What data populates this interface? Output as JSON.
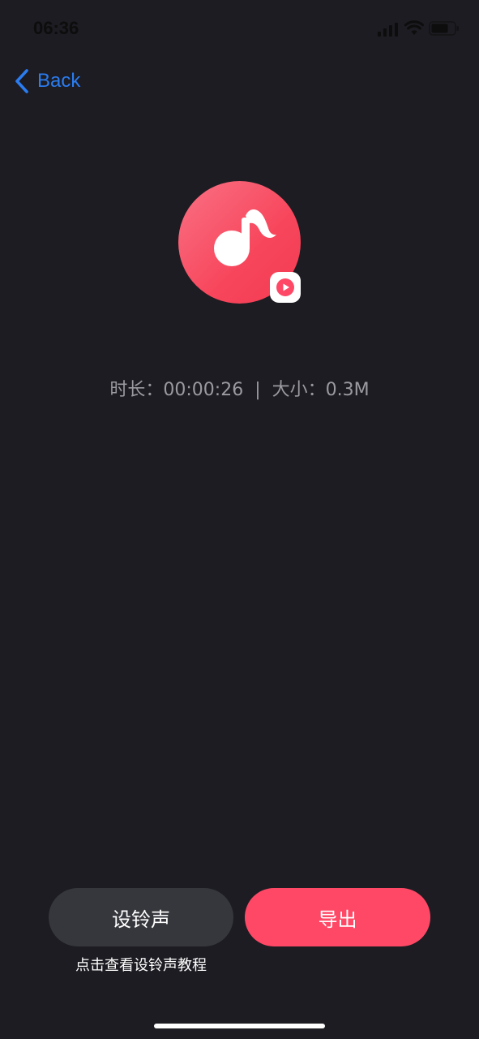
{
  "status_bar": {
    "time": "06:36",
    "icons": [
      "signal-icon",
      "wifi-icon",
      "battery-icon"
    ]
  },
  "nav": {
    "back_label": "Back",
    "back_icon": "chevron-left-icon"
  },
  "audio": {
    "icon": "music-note-icon",
    "badge_icon": "play-icon",
    "duration_label": "时长：",
    "duration": "00:00:26",
    "separator": "|",
    "size_label": "大小：",
    "size": "0.3M"
  },
  "actions": {
    "set_ringtone_label": "设铃声",
    "export_label": "导出",
    "tutorial_label": "点击查看设铃声教程"
  },
  "colors": {
    "background": "#1c1c22",
    "accent": "#ff4866",
    "link": "#2b7cf0",
    "secondary_button": "#36373c",
    "info_text": "#9a9aa0"
  }
}
